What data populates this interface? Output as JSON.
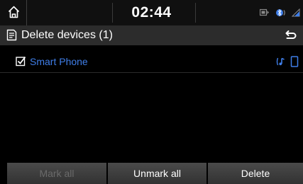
{
  "status_bar": {
    "time": "02:44",
    "icons": [
      "home-icon",
      "media-icon",
      "bluetooth-icon",
      "signal-icon"
    ]
  },
  "header": {
    "title": "Delete devices (1)",
    "icon": "list-icon",
    "back_icon": "back-arrow-icon"
  },
  "devices": [
    {
      "name": "Smart Phone",
      "checked": true,
      "icons": [
        "audio-streaming-icon",
        "phone-icon"
      ]
    }
  ],
  "buttons": {
    "mark_all": "Mark all",
    "mark_all_enabled": false,
    "unmark_all": "Unmark all",
    "delete": "Delete"
  },
  "colors": {
    "accent": "#3f7ee8",
    "background": "#000000",
    "header": "#2c2c2c",
    "disabled_text": "#6a6a6a"
  }
}
